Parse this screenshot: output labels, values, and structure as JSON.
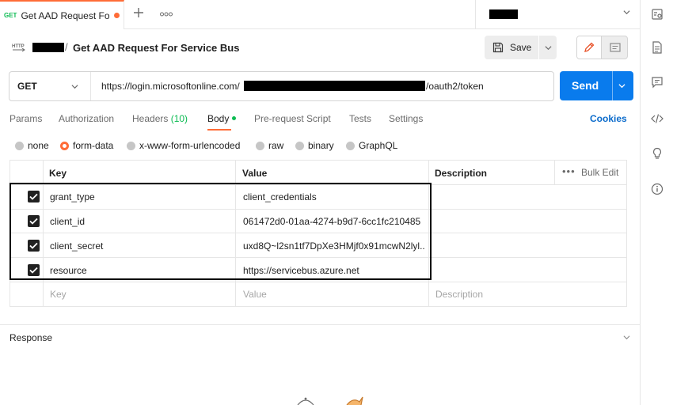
{
  "tab": {
    "method": "GET",
    "title": "Get AAD Request For Service Bus",
    "add_icon": "plus-icon",
    "more_icon": "more-horizontal-icon"
  },
  "request": {
    "breadcrumb_sep": "/",
    "title": "Get AAD Request For Service Bus",
    "save_label": "Save",
    "method": "GET",
    "url_prefix": "https://login.microsoftonline.com/",
    "url_suffix": "/oauth2/token",
    "send_label": "Send"
  },
  "tabs": {
    "params": "Params",
    "authorization": "Authorization",
    "headers": "Headers",
    "headers_count": "(10)",
    "body": "Body",
    "prerequest": "Pre-request Script",
    "tests": "Tests",
    "settings": "Settings",
    "cookies": "Cookies"
  },
  "body_types": {
    "none": "none",
    "form_data": "form-data",
    "urlencoded": "x-www-form-urlencoded",
    "raw": "raw",
    "binary": "binary",
    "graphql": "GraphQL",
    "selected": "form-data"
  },
  "table": {
    "headers": {
      "key": "Key",
      "value": "Value",
      "description": "Description",
      "bulk_edit": "Bulk Edit"
    },
    "rows": [
      {
        "key": "grant_type",
        "value": "client_credentials",
        "checked": true
      },
      {
        "key": "client_id",
        "value": "061472d0-01aa-4274-b9d7-6cc1fc210485",
        "checked": true
      },
      {
        "key": "client_secret",
        "value": "uxd8Q~l2sn1tf7DpXe3HMjf0x91mcwN2lyl...",
        "checked": true
      },
      {
        "key": "resource",
        "value": "https://servicebus.azure.net",
        "checked": true
      }
    ],
    "placeholders": {
      "key": "Key",
      "value": "Value",
      "description": "Description"
    }
  },
  "response": {
    "label": "Response"
  },
  "colors": {
    "accent": "#ff6c37",
    "send": "#097bed",
    "method_get": "#0cbb52",
    "link": "#0b6bcb"
  }
}
